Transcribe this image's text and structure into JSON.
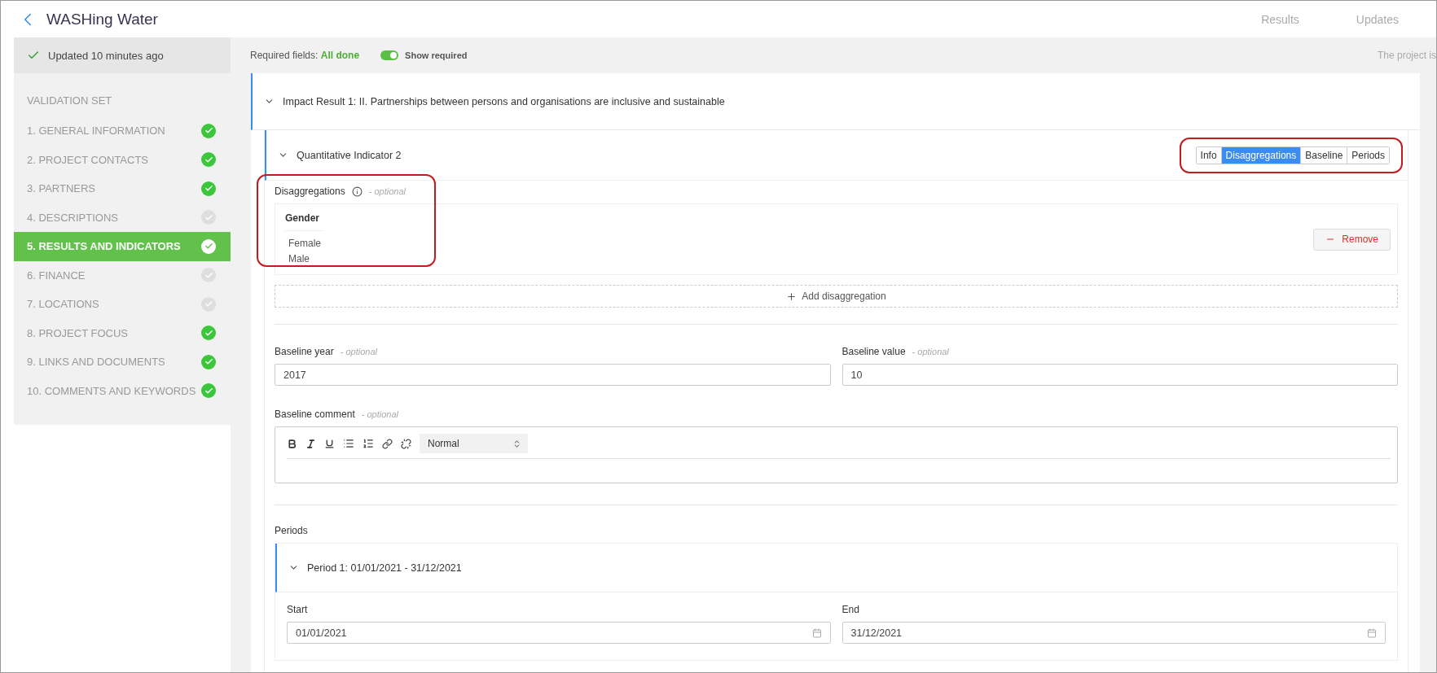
{
  "header": {
    "title": "WASHing Water",
    "nav": [
      {
        "label": "Results",
        "selected": false
      },
      {
        "label": "Updates",
        "selected": false
      }
    ]
  },
  "sidebar": {
    "status": "Updated 10 minutes ago",
    "section_label": "VALIDATION SET",
    "items": [
      {
        "label": "1. GENERAL INFORMATION",
        "done": true,
        "selected": false
      },
      {
        "label": "2. PROJECT CONTACTS",
        "done": true,
        "selected": false
      },
      {
        "label": "3. PARTNERS",
        "done": true,
        "selected": false
      },
      {
        "label": "4. DESCRIPTIONS",
        "done": false,
        "selected": false
      },
      {
        "label": "5. RESULTS AND INDICATORS",
        "done": true,
        "selected": true
      },
      {
        "label": "6. FINANCE",
        "done": false,
        "selected": false
      },
      {
        "label": "7. LOCATIONS",
        "done": false,
        "selected": false
      },
      {
        "label": "8. PROJECT FOCUS",
        "done": true,
        "selected": false
      },
      {
        "label": "9. LINKS AND DOCUMENTS",
        "done": true,
        "selected": false
      },
      {
        "label": "10. COMMENTS AND KEYWORDS",
        "done": true,
        "selected": false
      }
    ]
  },
  "topbar": {
    "required_label": "Required fields:",
    "required_status": "All done",
    "toggle": {
      "label": "Show required",
      "on": true
    },
    "note": "The project is"
  },
  "result": {
    "title": "Impact Result 1: II. Partnerships between persons and organisations are inclusive and sustainable",
    "expanded": true
  },
  "indicator": {
    "title": "Quantitative Indicator 2",
    "expanded": true,
    "tabs": [
      {
        "label": "Info",
        "selected": false
      },
      {
        "label": "Disaggregations",
        "selected": true
      },
      {
        "label": "Baseline",
        "selected": false
      },
      {
        "label": "Periods",
        "selected": false
      }
    ],
    "disaggregations": {
      "label": "Disaggregations",
      "hint": "- optional",
      "groups": [
        {
          "name": "Gender",
          "values": [
            "Female",
            "Male"
          ],
          "remove": "Remove"
        }
      ],
      "add": "Add disaggregation"
    },
    "baseline_year": {
      "label": "Baseline year",
      "hint": "- optional",
      "value": "2017"
    },
    "baseline_value": {
      "label": "Baseline value",
      "hint": "- optional",
      "value": "10"
    },
    "baseline_comment": {
      "label": "Baseline comment",
      "hint": "- optional",
      "format": "Normal"
    },
    "periods": {
      "label": "Periods",
      "items": [
        {
          "title": "Period 1: 01/01/2021 - 31/12/2021",
          "expanded": true,
          "start_label": "Start",
          "start": "01/01/2021",
          "end_label": "End",
          "end": "31/12/2021"
        }
      ]
    }
  }
}
